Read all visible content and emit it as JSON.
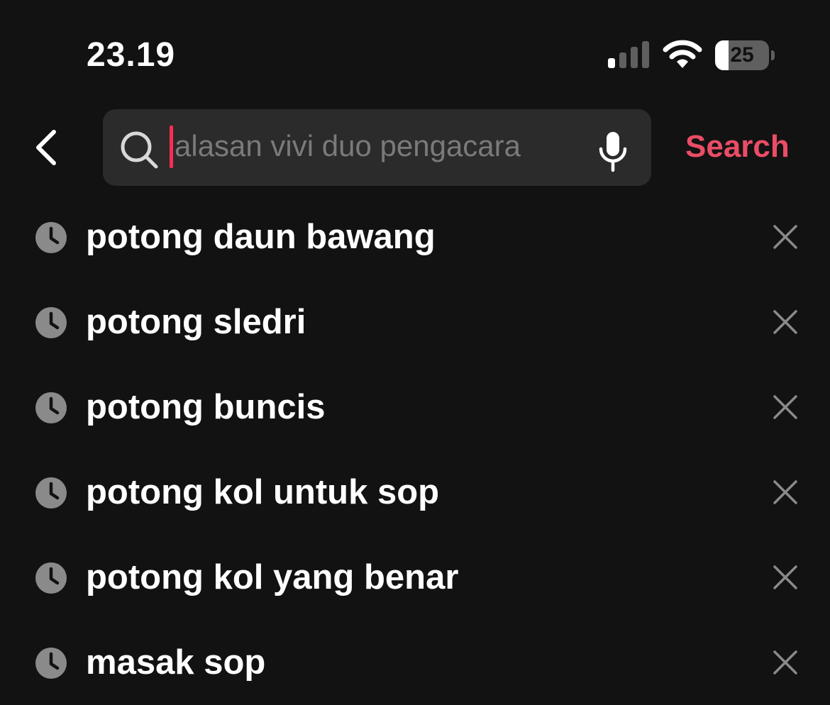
{
  "status_bar": {
    "time": "23.19",
    "battery_level": "25",
    "battery_fraction": 0.25,
    "icons": [
      "signal-icon",
      "wifi-icon",
      "battery-icon"
    ]
  },
  "search": {
    "placeholder": "alasan vivi duo pengacara",
    "value": "",
    "button_label": "Search",
    "accent_color": "#ea4d66",
    "caret_color": "#fe2c55",
    "icons": [
      "back-chevron-icon",
      "search-icon",
      "mic-icon"
    ]
  },
  "history": [
    {
      "label": "potong daun bawang"
    },
    {
      "label": "potong sledri"
    },
    {
      "label": "potong buncis"
    },
    {
      "label": "potong kol untuk sop"
    },
    {
      "label": "potong kol yang benar"
    },
    {
      "label": "masak sop"
    }
  ],
  "history_icons": [
    "clock-icon",
    "close-icon"
  ],
  "colors": {
    "background": "#121212",
    "search_field": "#2b2b2b",
    "text": "#ffffff",
    "placeholder": "#7a7a7a",
    "icon_gray": "#8a8a8a"
  }
}
